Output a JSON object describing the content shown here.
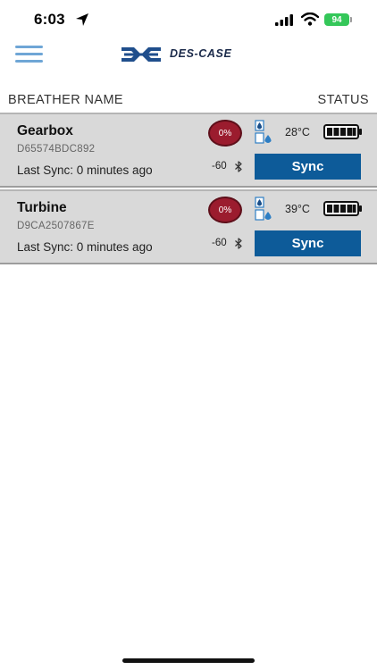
{
  "status_bar": {
    "time": "6:03",
    "battery": "94"
  },
  "header": {
    "logo_text": "DES-CASE"
  },
  "columns": {
    "name": "BREATHER NAME",
    "status": "STATUS"
  },
  "breathers": [
    {
      "name": "Gearbox",
      "id": "D65574BDC892",
      "last_sync": "Last Sync: 0 minutes ago",
      "humidity": "0%",
      "temperature": "28°C",
      "rssi": "-60",
      "sync_label": "Sync"
    },
    {
      "name": "Turbine",
      "id": "D9CA2507867E",
      "last_sync": "Last Sync: 0 minutes ago",
      "humidity": "0%",
      "temperature": "39°C",
      "rssi": "-60",
      "sync_label": "Sync"
    }
  ],
  "colors": {
    "accent": "#0d5b99",
    "menu": "#6fa6d6",
    "humidity": "#9b1c2e",
    "row_bg": "#d9d9d9",
    "battery_status": "#34c759"
  },
  "icons": {
    "location": "location-arrow-icon",
    "signal": "cellular-signal-icon",
    "wifi": "wifi-icon",
    "menu": "hamburger-menu-icon",
    "drops": "water-drop-icon",
    "battery": "battery-full-icon",
    "bluetooth": "bluetooth-icon"
  }
}
